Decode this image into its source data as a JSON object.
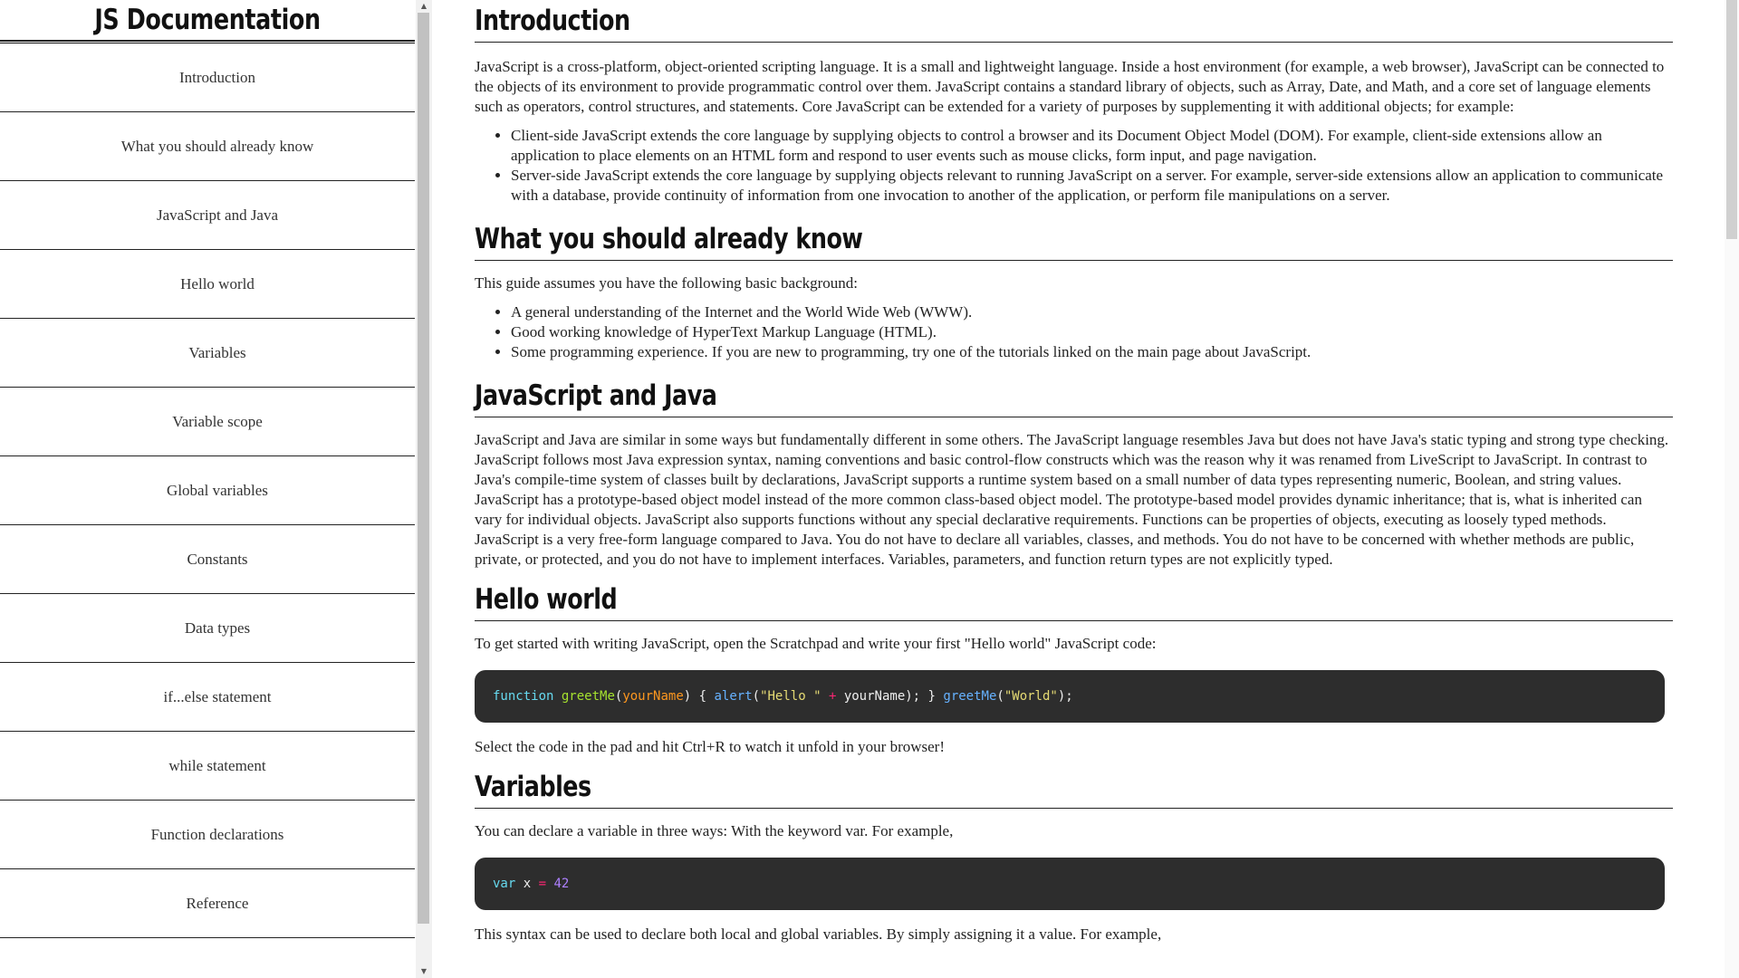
{
  "nav": {
    "header": "JS Documentation",
    "items": [
      {
        "label": "Introduction"
      },
      {
        "label": "What you should already know"
      },
      {
        "label": "JavaScript and Java"
      },
      {
        "label": "Hello world"
      },
      {
        "label": "Variables"
      },
      {
        "label": "Variable scope"
      },
      {
        "label": "Global variables"
      },
      {
        "label": "Constants"
      },
      {
        "label": "Data types"
      },
      {
        "label": "if...else statement"
      },
      {
        "label": "while statement"
      },
      {
        "label": "Function declarations"
      },
      {
        "label": "Reference"
      }
    ]
  },
  "sections": {
    "introduction": {
      "title": "Introduction",
      "p1": "JavaScript is a cross-platform, object-oriented scripting language. It is a small and lightweight language. Inside a host environment (for example, a web browser), JavaScript can be connected to the objects of its environment to provide programmatic control over them. JavaScript contains a standard library of objects, such as Array, Date, and Math, and a core set of language elements such as operators, control structures, and statements. Core JavaScript can be extended for a variety of purposes by supplementing it with additional objects; for example:",
      "bullets": [
        "Client-side JavaScript extends the core language by supplying objects to control a browser and its Document Object Model (DOM). For example, client-side extensions allow an application to place elements on an HTML form and respond to user events such as mouse clicks, form input, and page navigation.",
        "Server-side JavaScript extends the core language by supplying objects relevant to running JavaScript on a server. For example, server-side extensions allow an application to communicate with a database, provide continuity of information from one invocation to another of the application, or perform file manipulations on a server."
      ]
    },
    "what_you_should_know": {
      "title": "What you should already know",
      "p1": "This guide assumes you have the following basic background:",
      "bullets": [
        "A general understanding of the Internet and the World Wide Web (WWW).",
        "Good working knowledge of HyperText Markup Language (HTML).",
        "Some programming experience. If you are new to programming, try one of the tutorials linked on the main page about JavaScript."
      ]
    },
    "javascript_and_java": {
      "title": "JavaScript and Java",
      "p1": "JavaScript and Java are similar in some ways but fundamentally different in some others. The JavaScript language resembles Java but does not have Java's static typing and strong type checking. JavaScript follows most Java expression syntax, naming conventions and basic control-flow constructs which was the reason why it was renamed from LiveScript to JavaScript. In contrast to Java's compile-time system of classes built by declarations, JavaScript supports a runtime system based on a small number of data types representing numeric, Boolean, and string values. JavaScript has a prototype-based object model instead of the more common class-based object model. The prototype-based model provides dynamic inheritance; that is, what is inherited can vary for individual objects. JavaScript also supports functions without any special declarative requirements. Functions can be properties of objects, executing as loosely typed methods. JavaScript is a very free-form language compared to Java. You do not have to declare all variables, classes, and methods. You do not have to be concerned with whether methods are public, private, or protected, and you do not have to implement interfaces. Variables, parameters, and function return types are not explicitly typed."
    },
    "hello_world": {
      "title": "Hello world",
      "p1": "To get started with writing JavaScript, open the Scratchpad and write your first \"Hello world\" JavaScript code:",
      "code_tokens": {
        "t1": "function",
        "t2": " ",
        "t3": "greetMe",
        "t4": "(",
        "t5": "yourName",
        "t6": ") { ",
        "t7": "alert",
        "t8": "(",
        "t9": "\"Hello \"",
        "t10": " + ",
        "t11": "yourName); } ",
        "t12": "greetMe",
        "t13": "(",
        "t14": "\"World\"",
        "t15": ");"
      },
      "p2": "Select the code in the pad and hit Ctrl+R to watch it unfold in your browser!"
    },
    "variables": {
      "title": "Variables",
      "p1": "You can declare a variable in three ways: With the keyword var. For example,",
      "code_tokens": {
        "t1": "var",
        "t2": " x ",
        "t3": "=",
        "t4": " ",
        "t5": "42"
      },
      "p2": "This syntax can be used to declare both local and global variables. By simply assigning it a value. For example,"
    }
  },
  "colors": {
    "code_bg": "#2d2d2d",
    "keyword": "#66d9ef",
    "function_name": "#a6e22e",
    "param": "#fd971f",
    "string": "#e6db74",
    "operator": "#f92672",
    "number": "#ae81ff"
  }
}
